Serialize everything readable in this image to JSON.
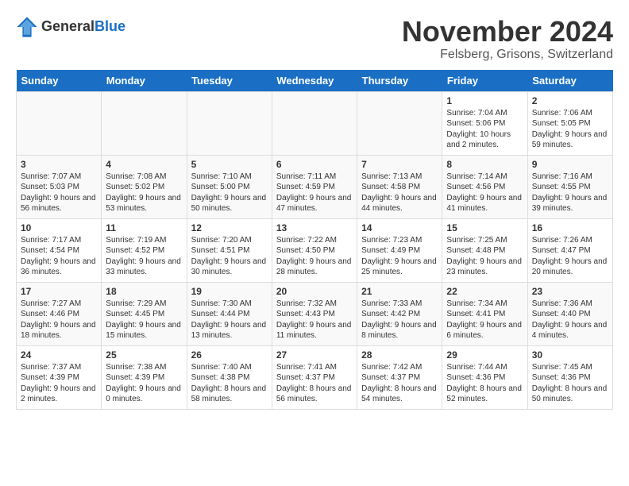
{
  "logo": {
    "general": "General",
    "blue": "Blue"
  },
  "title": "November 2024",
  "location": "Felsberg, Grisons, Switzerland",
  "days_of_week": [
    "Sunday",
    "Monday",
    "Tuesday",
    "Wednesday",
    "Thursday",
    "Friday",
    "Saturday"
  ],
  "weeks": [
    [
      {
        "day": "",
        "info": ""
      },
      {
        "day": "",
        "info": ""
      },
      {
        "day": "",
        "info": ""
      },
      {
        "day": "",
        "info": ""
      },
      {
        "day": "",
        "info": ""
      },
      {
        "day": "1",
        "info": "Sunrise: 7:04 AM\nSunset: 5:06 PM\nDaylight: 10 hours\nand 2 minutes."
      },
      {
        "day": "2",
        "info": "Sunrise: 7:06 AM\nSunset: 5:05 PM\nDaylight: 9 hours\nand 59 minutes."
      }
    ],
    [
      {
        "day": "3",
        "info": "Sunrise: 7:07 AM\nSunset: 5:03 PM\nDaylight: 9 hours\nand 56 minutes."
      },
      {
        "day": "4",
        "info": "Sunrise: 7:08 AM\nSunset: 5:02 PM\nDaylight: 9 hours\nand 53 minutes."
      },
      {
        "day": "5",
        "info": "Sunrise: 7:10 AM\nSunset: 5:00 PM\nDaylight: 9 hours\nand 50 minutes."
      },
      {
        "day": "6",
        "info": "Sunrise: 7:11 AM\nSunset: 4:59 PM\nDaylight: 9 hours\nand 47 minutes."
      },
      {
        "day": "7",
        "info": "Sunrise: 7:13 AM\nSunset: 4:58 PM\nDaylight: 9 hours\nand 44 minutes."
      },
      {
        "day": "8",
        "info": "Sunrise: 7:14 AM\nSunset: 4:56 PM\nDaylight: 9 hours\nand 41 minutes."
      },
      {
        "day": "9",
        "info": "Sunrise: 7:16 AM\nSunset: 4:55 PM\nDaylight: 9 hours\nand 39 minutes."
      }
    ],
    [
      {
        "day": "10",
        "info": "Sunrise: 7:17 AM\nSunset: 4:54 PM\nDaylight: 9 hours\nand 36 minutes."
      },
      {
        "day": "11",
        "info": "Sunrise: 7:19 AM\nSunset: 4:52 PM\nDaylight: 9 hours\nand 33 minutes."
      },
      {
        "day": "12",
        "info": "Sunrise: 7:20 AM\nSunset: 4:51 PM\nDaylight: 9 hours\nand 30 minutes."
      },
      {
        "day": "13",
        "info": "Sunrise: 7:22 AM\nSunset: 4:50 PM\nDaylight: 9 hours\nand 28 minutes."
      },
      {
        "day": "14",
        "info": "Sunrise: 7:23 AM\nSunset: 4:49 PM\nDaylight: 9 hours\nand 25 minutes."
      },
      {
        "day": "15",
        "info": "Sunrise: 7:25 AM\nSunset: 4:48 PM\nDaylight: 9 hours\nand 23 minutes."
      },
      {
        "day": "16",
        "info": "Sunrise: 7:26 AM\nSunset: 4:47 PM\nDaylight: 9 hours\nand 20 minutes."
      }
    ],
    [
      {
        "day": "17",
        "info": "Sunrise: 7:27 AM\nSunset: 4:46 PM\nDaylight: 9 hours\nand 18 minutes."
      },
      {
        "day": "18",
        "info": "Sunrise: 7:29 AM\nSunset: 4:45 PM\nDaylight: 9 hours\nand 15 minutes."
      },
      {
        "day": "19",
        "info": "Sunrise: 7:30 AM\nSunset: 4:44 PM\nDaylight: 9 hours\nand 13 minutes."
      },
      {
        "day": "20",
        "info": "Sunrise: 7:32 AM\nSunset: 4:43 PM\nDaylight: 9 hours\nand 11 minutes."
      },
      {
        "day": "21",
        "info": "Sunrise: 7:33 AM\nSunset: 4:42 PM\nDaylight: 9 hours\nand 8 minutes."
      },
      {
        "day": "22",
        "info": "Sunrise: 7:34 AM\nSunset: 4:41 PM\nDaylight: 9 hours\nand 6 minutes."
      },
      {
        "day": "23",
        "info": "Sunrise: 7:36 AM\nSunset: 4:40 PM\nDaylight: 9 hours\nand 4 minutes."
      }
    ],
    [
      {
        "day": "24",
        "info": "Sunrise: 7:37 AM\nSunset: 4:39 PM\nDaylight: 9 hours\nand 2 minutes."
      },
      {
        "day": "25",
        "info": "Sunrise: 7:38 AM\nSunset: 4:39 PM\nDaylight: 9 hours\nand 0 minutes."
      },
      {
        "day": "26",
        "info": "Sunrise: 7:40 AM\nSunset: 4:38 PM\nDaylight: 8 hours\nand 58 minutes."
      },
      {
        "day": "27",
        "info": "Sunrise: 7:41 AM\nSunset: 4:37 PM\nDaylight: 8 hours\nand 56 minutes."
      },
      {
        "day": "28",
        "info": "Sunrise: 7:42 AM\nSunset: 4:37 PM\nDaylight: 8 hours\nand 54 minutes."
      },
      {
        "day": "29",
        "info": "Sunrise: 7:44 AM\nSunset: 4:36 PM\nDaylight: 8 hours\nand 52 minutes."
      },
      {
        "day": "30",
        "info": "Sunrise: 7:45 AM\nSunset: 4:36 PM\nDaylight: 8 hours\nand 50 minutes."
      }
    ]
  ]
}
